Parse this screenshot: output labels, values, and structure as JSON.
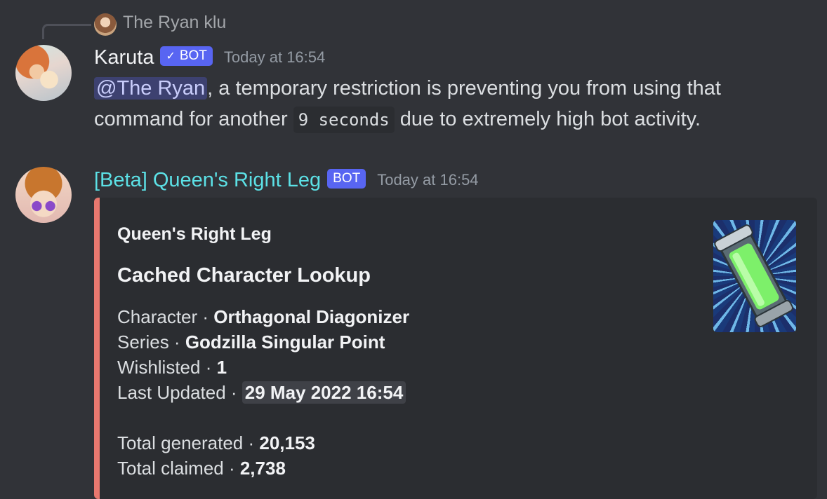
{
  "reply": {
    "author": "The Ryan klu"
  },
  "messages": [
    {
      "author": "Karuta",
      "bot_tag": "BOT",
      "verified_check": "✓",
      "timestamp": "Today at 16:54",
      "mention": "@The Ryan",
      "text_part1": ", a temporary restriction is preventing you from using that command for another ",
      "code": "9 seconds",
      "text_part2": " due to extremely high bot activity."
    },
    {
      "author": "[Beta] Queen's Right Leg",
      "bot_tag": "BOT",
      "timestamp": "Today at 16:54",
      "name_color": "#5ce1e6",
      "embed": {
        "accent_color": "#e8786f",
        "author": "Queen's Right Leg",
        "title": "Cached Character Lookup",
        "separator": " · ",
        "fields": {
          "character_label": "Character",
          "character_value": "Orthagonal Diagonizer",
          "series_label": "Series",
          "series_value": "Godzilla Singular Point",
          "wishlisted_label": "Wishlisted",
          "wishlisted_value": "1",
          "updated_label": "Last Updated",
          "updated_value": "29 May 2022 16:54",
          "generated_label": "Total generated",
          "generated_value": "20,153",
          "claimed_label": "Total claimed",
          "claimed_value": "2,738"
        }
      }
    }
  ]
}
